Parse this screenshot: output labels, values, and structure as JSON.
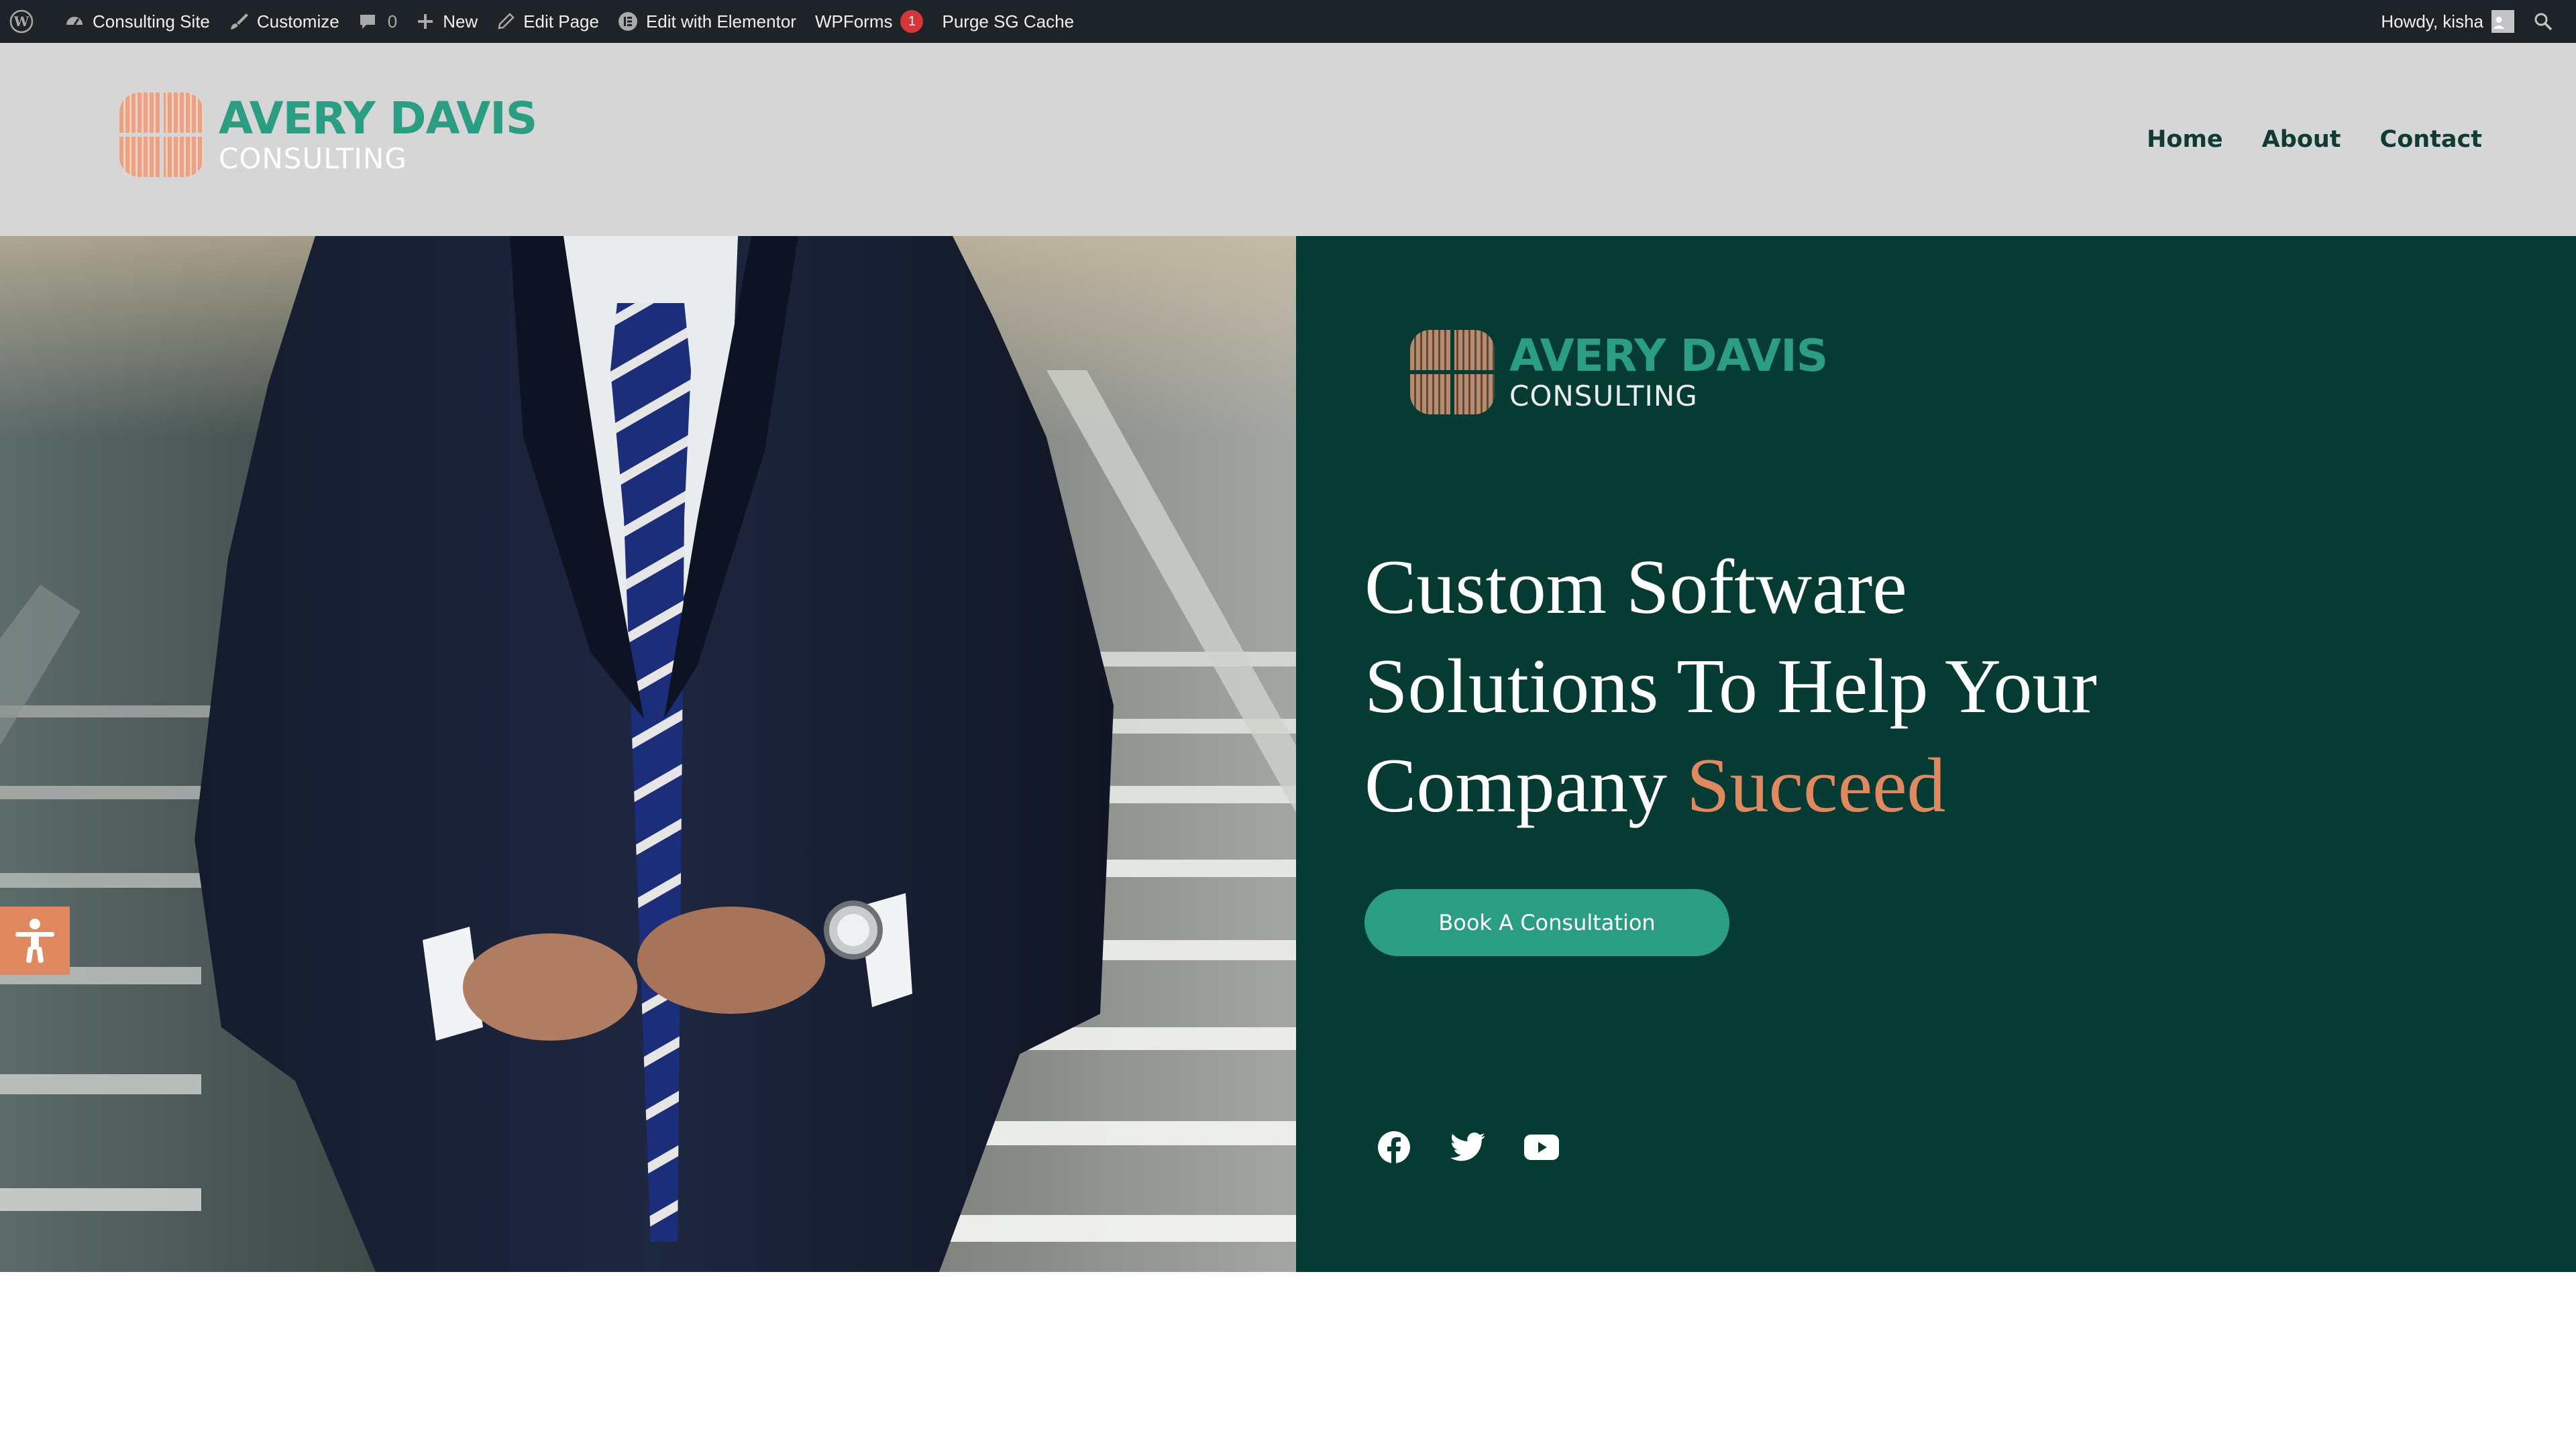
{
  "admin_bar": {
    "site_name": "Consulting Site",
    "customize": "Customize",
    "comments_count": "0",
    "new": "New",
    "edit_page": "Edit Page",
    "edit_elementor": "Edit with Elementor",
    "wpforms": "WPForms",
    "wpforms_badge": "1",
    "purge_cache": "Purge SG Cache",
    "greeting": "Howdy, kisha"
  },
  "header": {
    "logo": {
      "name": "AVERY DAVIS",
      "sub": "CONSULTING"
    },
    "nav": [
      "Home",
      "About",
      "Contact"
    ]
  },
  "hero": {
    "logo": {
      "name": "AVERY DAVIS",
      "sub": "CONSULTING"
    },
    "title_lines": [
      "Custom Software",
      "Solutions To Help Your",
      "Company "
    ],
    "title_accent": "Succeed",
    "cta": "Book A Consultation",
    "social": [
      "facebook-icon",
      "twitter-icon",
      "youtube-icon"
    ]
  },
  "colors": {
    "admin_bar": "#1d2327",
    "header_bg": "#d6d6d6",
    "panel_bg": "#053b33",
    "brand_green": "#2a9d82",
    "accent_orange": "#e0885f",
    "nav_text": "#0f3b33"
  }
}
